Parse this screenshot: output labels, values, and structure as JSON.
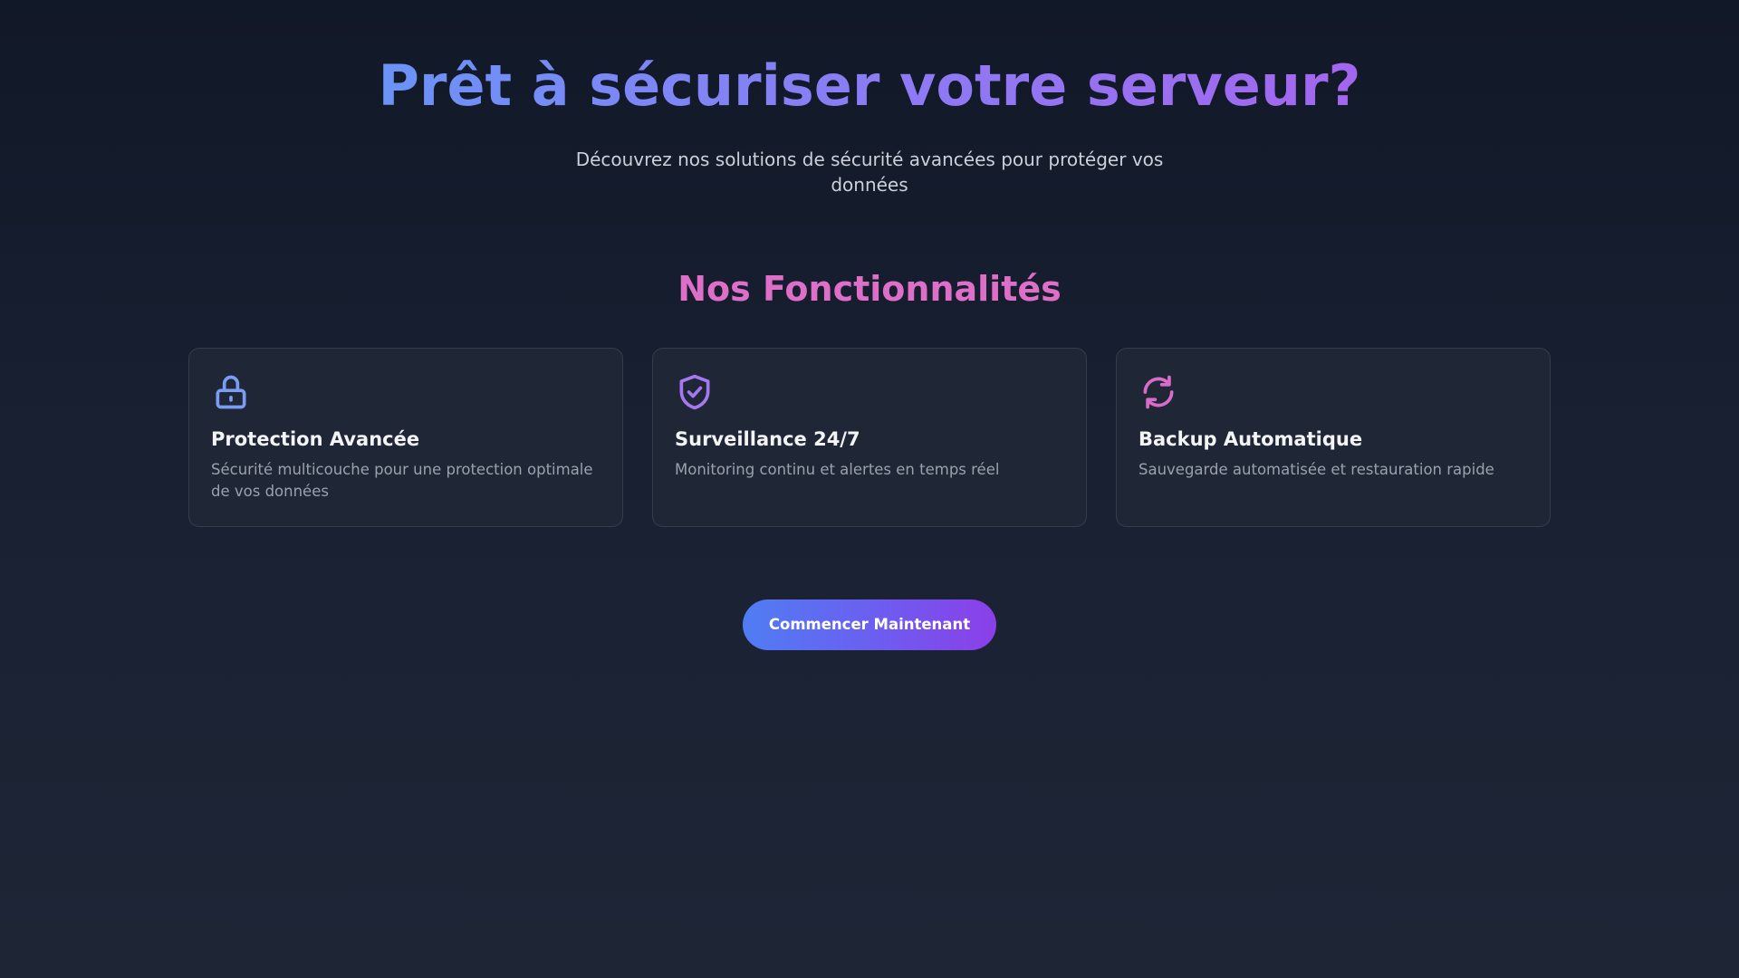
{
  "hero": {
    "title": "Prêt à sécuriser votre serveur?",
    "subtitle": "Découvrez nos solutions de sécurité avancées pour protéger vos données"
  },
  "features": {
    "heading": "Nos Fonctionnalités",
    "items": [
      {
        "icon": "lock-icon",
        "icon_color": "#7b9cf5",
        "title": "Protection Avancée",
        "description": "Sécurité multicouche pour une protection optimale de vos données"
      },
      {
        "icon": "shield-check-icon",
        "icon_color": "#a678ef",
        "title": "Surveillance 24/7",
        "description": "Monitoring continu et alertes en temps réel"
      },
      {
        "icon": "refresh-icon",
        "icon_color": "#d96ccb",
        "title": "Backup Automatique",
        "description": "Sauvegarde automatisée et restauration rapide"
      }
    ]
  },
  "cta": {
    "label": "Commencer Maintenant"
  },
  "colors": {
    "background_top": "#111827",
    "background_bottom": "#1e2636",
    "title_gradient_start": "#6b93f6",
    "title_gradient_end": "#a366ee",
    "features_heading": "#dd6fc9",
    "button_gradient_start": "#4f7df3",
    "button_gradient_end": "#8b3fe8"
  }
}
